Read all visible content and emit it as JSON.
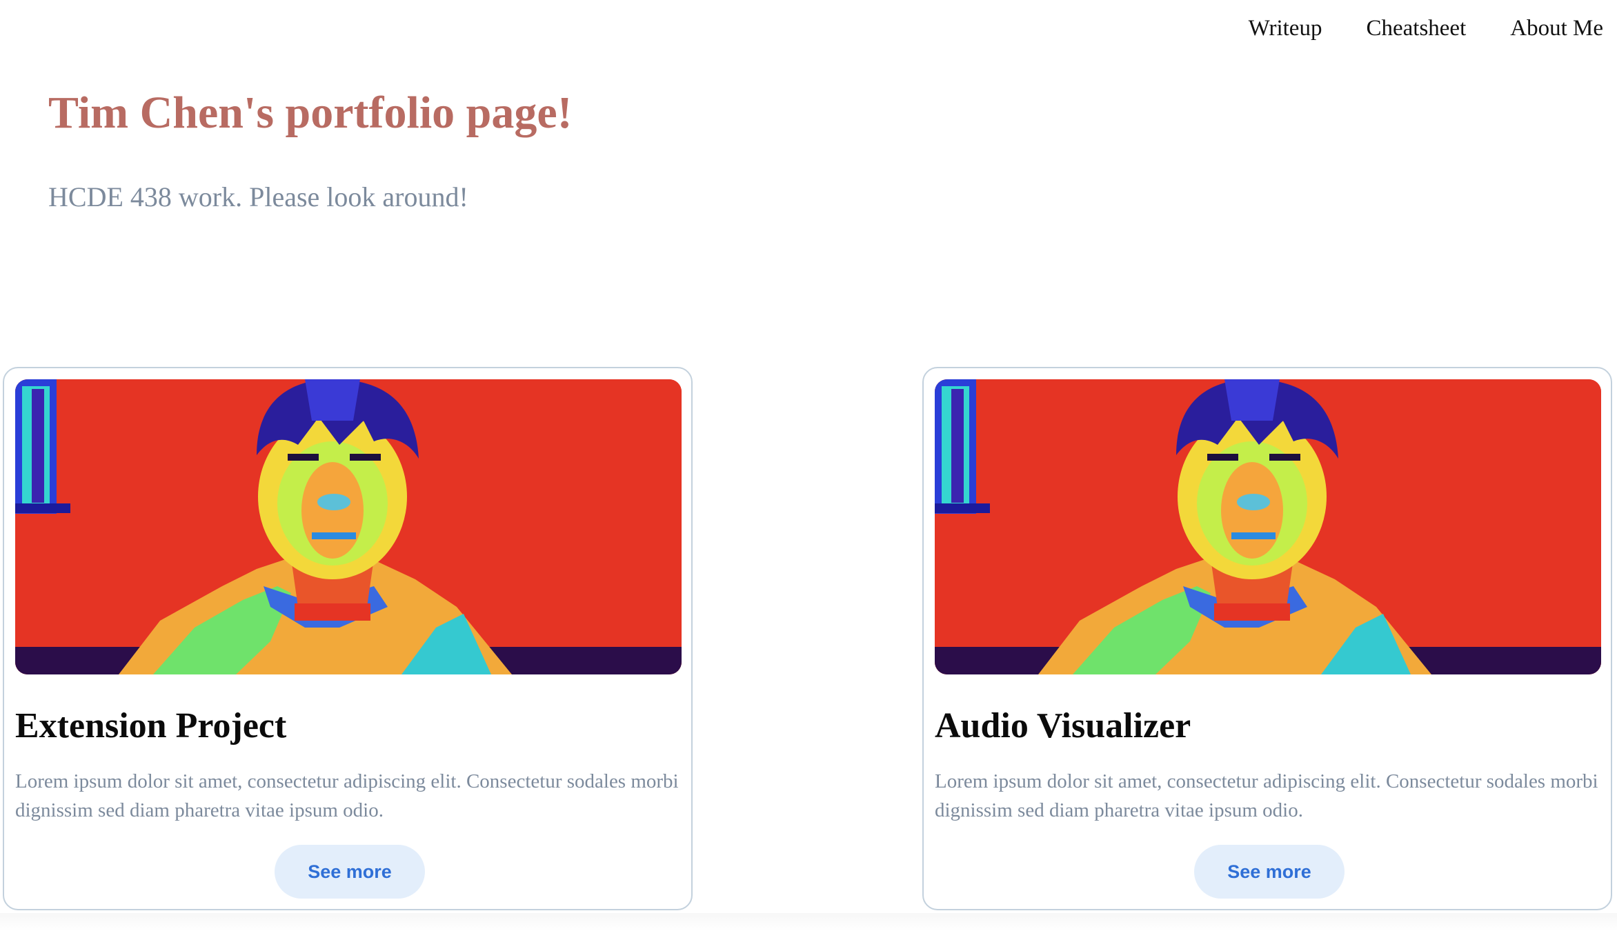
{
  "nav": {
    "links": [
      {
        "label": "Writeup"
      },
      {
        "label": "Cheatsheet"
      },
      {
        "label": "About Me"
      }
    ]
  },
  "hero": {
    "title": "Tim Chen's portfolio page!",
    "subtitle": "HCDE 438 work. Please look around!"
  },
  "cards": [
    {
      "title": "Extension Project",
      "description": "Lorem ipsum dolor sit amet, consectetur adipiscing elit. Consectetur sodales morbi dignissim sed diam pharetra vitae ipsum odio.",
      "button_label": "See more"
    },
    {
      "title": "Audio Visualizer",
      "description": "Lorem ipsum dolor sit amet, consectetur adipiscing elit. Consectetur sodales morbi dignissim sed diam pharetra vitae ipsum odio.",
      "button_label": "See more"
    }
  ],
  "colors": {
    "title": "#b86b62",
    "subtitle": "#7c8a9c",
    "button_bg": "#e3eefb",
    "button_text": "#2f6fd6",
    "card_border": "#c3d1dd",
    "image_background": "#e53424"
  }
}
